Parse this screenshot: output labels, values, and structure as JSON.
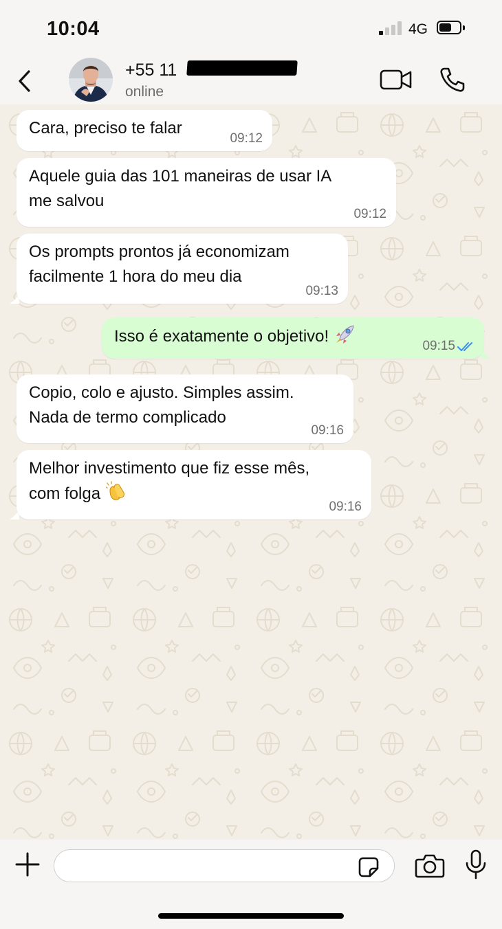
{
  "status_bar": {
    "time": "10:04",
    "network": "4G",
    "signal_bars_on": 1,
    "signal_bars_total": 4,
    "battery_level": 0.6
  },
  "header": {
    "contact_name_prefix": "+55 11",
    "contact_status": "online",
    "icons": [
      "back-chevron-icon",
      "video-camera-icon",
      "phone-icon"
    ]
  },
  "messages": [
    {
      "direction": "in",
      "text": "Cara, preciso te falar",
      "time": "09:12"
    },
    {
      "direction": "in",
      "text": "Aquele guia das 101 maneiras de usar IA\nme salvou",
      "time": "09:12"
    },
    {
      "direction": "in",
      "text": "Os prompts prontos já economizam\nfacilmente 1 hora do meu dia",
      "time": "09:13"
    },
    {
      "direction": "out",
      "text": "Isso é exatamente o objetivo!",
      "emoji": "rocket-emoji",
      "time": "09:15",
      "status": "read"
    },
    {
      "direction": "in",
      "text": "Copio, colo e ajusto. Simples assim.\nNada de termo complicado",
      "time": "09:16"
    },
    {
      "direction": "in",
      "text": "Melhor investimento que fiz esse mês,\ncom folga",
      "emoji": "clapping-hands-emoji",
      "time": "09:16"
    }
  ],
  "input_bar": {
    "message_value": "",
    "icons": [
      "plus-icon",
      "sticker-icon",
      "camera-icon",
      "microphone-icon"
    ]
  },
  "colors": {
    "incoming_bubble": "#ffffff",
    "outgoing_bubble": "#d9fdd3",
    "read_ticks": "#3a8ef6",
    "chat_background": "#f3efe7"
  }
}
